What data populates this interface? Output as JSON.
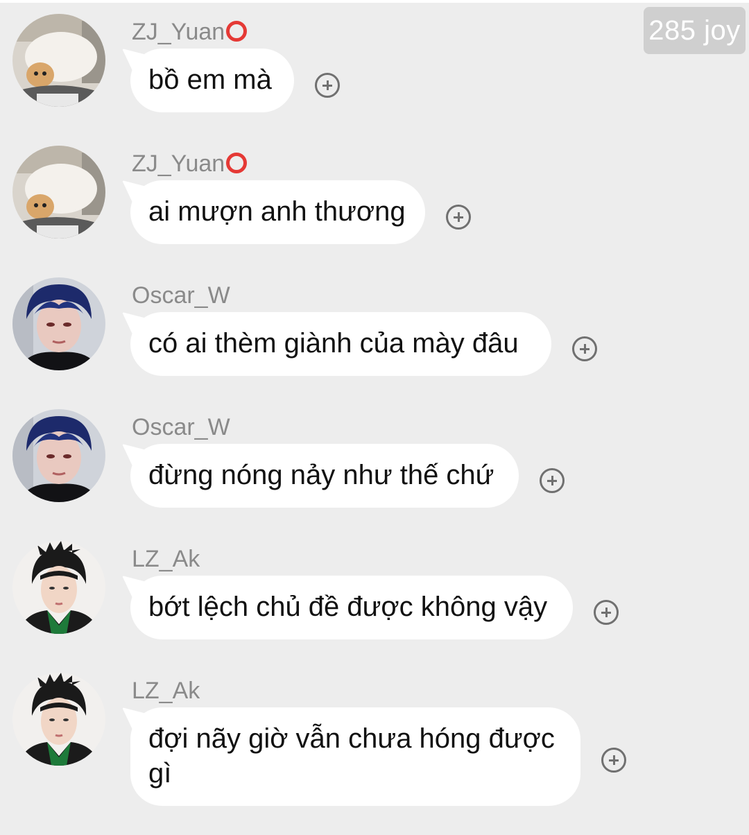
{
  "watermark": "285 joy",
  "messages": [
    {
      "sender": "ZJ_Yuan",
      "badge": true,
      "avatar_icon": "cat-avatar",
      "text": "bồ em mà"
    },
    {
      "sender": "ZJ_Yuan",
      "badge": true,
      "avatar_icon": "cat-avatar",
      "text": "ai mượn anh thương"
    },
    {
      "sender": "Oscar_W",
      "badge": false,
      "avatar_icon": "person-blue-hair-avatar",
      "text": "có ai thèm giành của mày đâu"
    },
    {
      "sender": "Oscar_W",
      "badge": false,
      "avatar_icon": "person-blue-hair-avatar",
      "text": "đừng nóng nảy như thế chứ"
    },
    {
      "sender": "LZ_Ak",
      "badge": false,
      "avatar_icon": "person-black-hair-avatar",
      "text": "bớt lệch chủ đề được không vậy"
    },
    {
      "sender": "LZ_Ak",
      "badge": false,
      "avatar_icon": "person-black-hair-avatar",
      "text": "đợi nãy giờ vẫn chưa hóng được gì"
    }
  ],
  "colors": {
    "background": "#ededed",
    "bubble": "#ffffff",
    "sender_text": "#8a8a8a",
    "badge": "#e53935",
    "add_icon": "#707070"
  }
}
